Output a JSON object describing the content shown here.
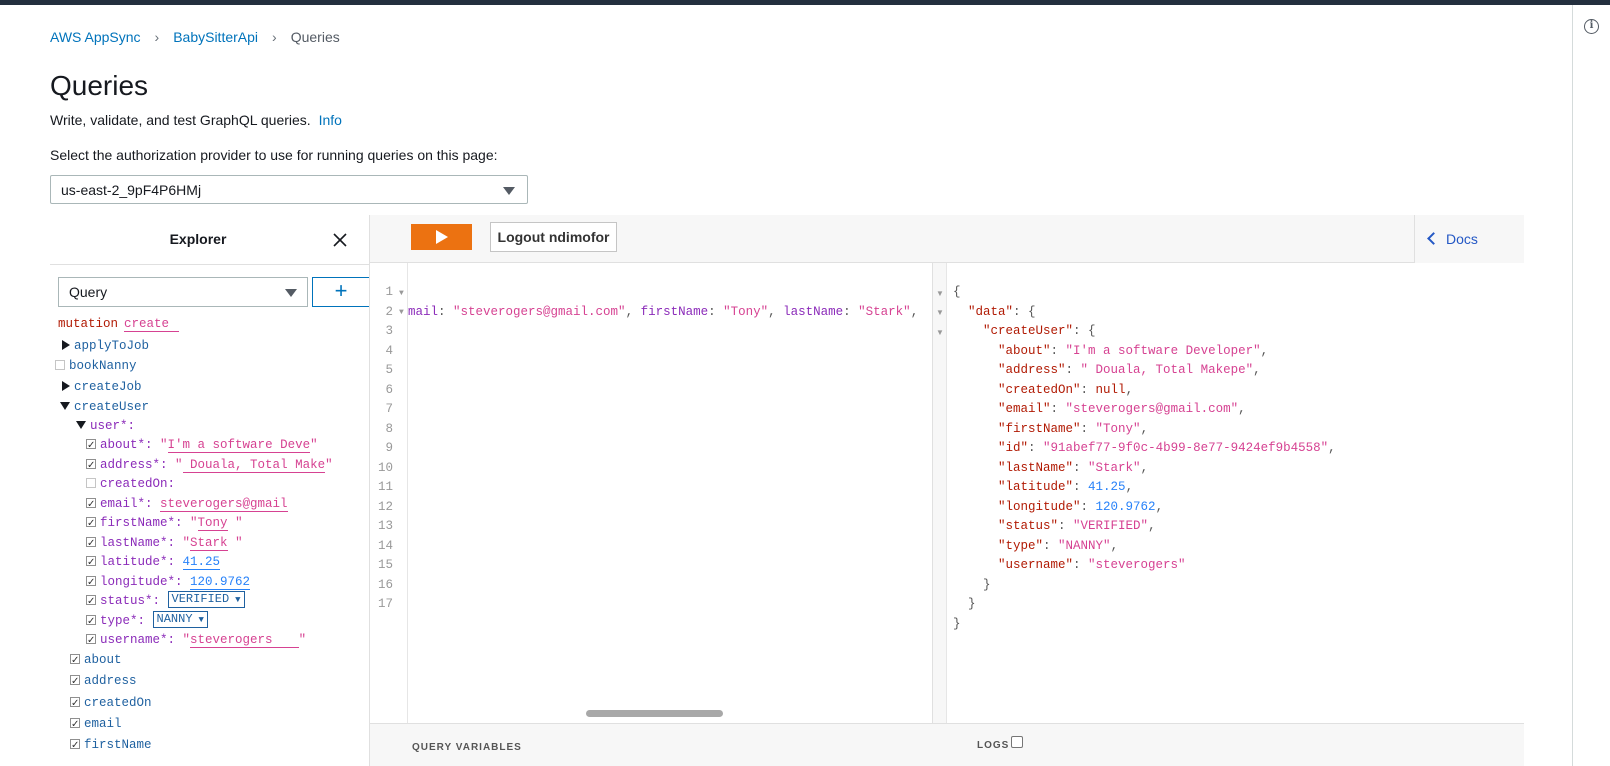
{
  "breadcrumb": {
    "items": [
      "AWS AppSync",
      "BabySitterApi"
    ],
    "current": "Queries"
  },
  "page": {
    "title": "Queries",
    "description": "Write, validate, and test GraphQL queries.",
    "info_link": "Info",
    "auth_label": "Select the authorization provider to use for running queries on this page:",
    "auth_provider": "us-east-2_9pF4P6HMj"
  },
  "explorer": {
    "title": "Explorer",
    "operation_type": "Query",
    "add_label": "+",
    "mutation_keyword": "mutation",
    "mutation_name": "create",
    "items": {
      "applyToJob": "applyToJob",
      "bookNanny": "bookNanny",
      "createJob": "createJob",
      "createUser": "createUser",
      "user": "user*:"
    },
    "args": {
      "about_label": "about*:",
      "about_value": "I'm a software Deve",
      "address_label": "address*:",
      "address_value": " Douala, Total Make",
      "createdOn_label": "createdOn:",
      "email_label": "email*:",
      "email_value": "steverogers@gmail",
      "firstName_label": "firstName*:",
      "firstName_value": "Tony",
      "lastName_label": "lastName*:",
      "lastName_value": "Stark",
      "latitude_label": "latitude*:",
      "latitude_value": "41.25",
      "longitude_label": "longitude*:",
      "longitude_value": "120.9762",
      "status_label": "status*:",
      "status_value": "VERIFIED",
      "type_label": "type*:",
      "type_value": "NANNY",
      "username_label": "username*:",
      "username_value": "steverogers"
    },
    "fields": [
      "about",
      "address",
      "createdOn",
      "email",
      "firstName"
    ]
  },
  "toolbar": {
    "logout_label": "Logout ndimofor",
    "docs_label": "Docs"
  },
  "query_editor": {
    "line_numbers": [
      "1",
      "2",
      "3",
      "4",
      "5",
      "6",
      "7",
      "8",
      "9",
      "10",
      "11",
      "12",
      "13",
      "14",
      "15",
      "16",
      "17"
    ],
    "line2": {
      "p1": "mail",
      "p2": ": ",
      "p3": "\"steverogers@gmail.com\"",
      "p4": ", ",
      "p5": "firstName",
      "p6": ": ",
      "p7": "\"Tony\"",
      "p8": ",  ",
      "p9": "lastName",
      "p10": ": ",
      "p11": "\"Stark\"",
      "p12": ","
    },
    "variables_label": "QUERY VARIABLES"
  },
  "result": {
    "lines": [
      {
        "indent": "",
        "key": "",
        "sep": "",
        "value": "{",
        "vtype": "punct"
      },
      {
        "indent": "  ",
        "key": "\"data\"",
        "sep": ": ",
        "value": "{",
        "vtype": "punct"
      },
      {
        "indent": "    ",
        "key": "\"createUser\"",
        "sep": ": ",
        "value": "{",
        "vtype": "punct"
      },
      {
        "indent": "      ",
        "key": "\"about\"",
        "sep": ": ",
        "value": "\"I'm a software Developer\"",
        "vtype": "str",
        "tail": ","
      },
      {
        "indent": "      ",
        "key": "\"address\"",
        "sep": ": ",
        "value": "\" Douala, Total Makepe\"",
        "vtype": "str",
        "tail": ","
      },
      {
        "indent": "      ",
        "key": "\"createdOn\"",
        "sep": ": ",
        "value": "null",
        "vtype": "null",
        "tail": ","
      },
      {
        "indent": "      ",
        "key": "\"email\"",
        "sep": ": ",
        "value": "\"steverogers@gmail.com\"",
        "vtype": "str",
        "tail": ","
      },
      {
        "indent": "      ",
        "key": "\"firstName\"",
        "sep": ": ",
        "value": "\"Tony\"",
        "vtype": "str",
        "tail": ","
      },
      {
        "indent": "      ",
        "key": "\"id\"",
        "sep": ": ",
        "value": "\"91abef77-9f0c-4b99-8e77-9424ef9b4558\"",
        "vtype": "str",
        "tail": ","
      },
      {
        "indent": "      ",
        "key": "\"lastName\"",
        "sep": ": ",
        "value": "\"Stark\"",
        "vtype": "str",
        "tail": ","
      },
      {
        "indent": "      ",
        "key": "\"latitude\"",
        "sep": ": ",
        "value": "41.25",
        "vtype": "num",
        "tail": ","
      },
      {
        "indent": "      ",
        "key": "\"longitude\"",
        "sep": ": ",
        "value": "120.9762",
        "vtype": "num",
        "tail": ","
      },
      {
        "indent": "      ",
        "key": "\"status\"",
        "sep": ": ",
        "value": "\"VERIFIED\"",
        "vtype": "str",
        "tail": ","
      },
      {
        "indent": "      ",
        "key": "\"type\"",
        "sep": ": ",
        "value": "\"NANNY\"",
        "vtype": "str",
        "tail": ","
      },
      {
        "indent": "      ",
        "key": "\"username\"",
        "sep": ": ",
        "value": "\"steverogers\"",
        "vtype": "str",
        "tail": ""
      },
      {
        "indent": "    ",
        "key": "",
        "sep": "",
        "value": "}",
        "vtype": "punct"
      },
      {
        "indent": "  ",
        "key": "",
        "sep": "",
        "value": "}",
        "vtype": "punct"
      },
      {
        "indent": "",
        "key": "",
        "sep": "",
        "value": "}",
        "vtype": "punct"
      }
    ],
    "logs_label": "LOGS"
  },
  "colors": {
    "run_button": "#ec7211",
    "link": "#0073bb",
    "json_key": "#b11a04",
    "json_string": "#d64292",
    "json_number": "#2882f9",
    "field_name": "#1f61a0",
    "arg_name": "#8b2bb9"
  }
}
